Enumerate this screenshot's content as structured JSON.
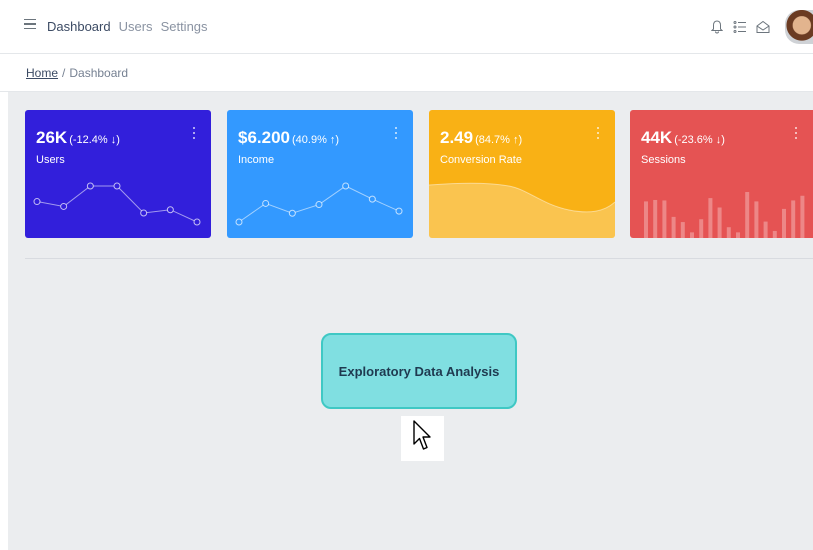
{
  "header": {
    "nav": [
      "Dashboard",
      "Users",
      "Settings"
    ],
    "icons": [
      "bell-icon",
      "list-icon",
      "envelope-icon"
    ]
  },
  "breadcrumb": {
    "home": "Home",
    "separator": "/",
    "current": "Dashboard"
  },
  "cards": [
    {
      "value": "26K",
      "change": "(-12.4% ↓)",
      "label": "Users",
      "color": "#321fdb",
      "chart": "line",
      "points": [
        65,
        59,
        84,
        84,
        51,
        55,
        40
      ]
    },
    {
      "value": "$6.200",
      "change": "(40.9% ↑)",
      "label": "Income",
      "color": "#39f",
      "chart": "line",
      "points": [
        1,
        18,
        9,
        17,
        34,
        22,
        11
      ]
    },
    {
      "value": "2.49",
      "change": "(84.7% ↑)",
      "label": "Conversion Rate",
      "color": "#f9b115",
      "chart": "area"
    },
    {
      "value": "44K",
      "change": "(-23.6% ↓)",
      "label": "Sessions",
      "color": "#e55353",
      "chart": "bar",
      "bars": [
        78,
        81,
        80,
        45,
        34,
        12,
        40,
        85,
        65,
        23,
        12,
        98,
        78,
        35,
        15,
        62,
        80,
        90
      ]
    }
  ],
  "main_button": {
    "label": "Exploratory Data Analysis"
  }
}
